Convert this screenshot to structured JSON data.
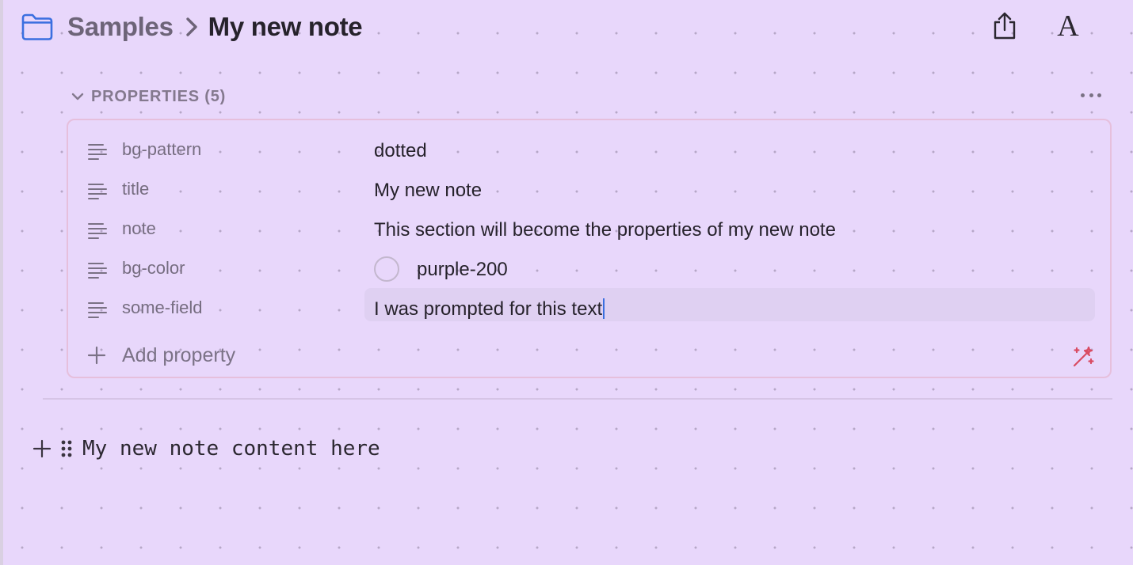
{
  "header": {
    "breadcrumb_parent": "Samples",
    "breadcrumb_current": "My new note",
    "font_button_glyph": "A",
    "icons": [
      "folder-icon",
      "chevron-right-icon",
      "share-icon",
      "font-icon",
      "more-icon"
    ]
  },
  "properties": {
    "title": "PROPERTIES (5)",
    "items": [
      {
        "key": "bg-pattern",
        "value": "dotted"
      },
      {
        "key": "title",
        "value": "My new note"
      },
      {
        "key": "note",
        "value": "This section will become the properties of my new note"
      },
      {
        "key": "bg-color",
        "value": "purple-200"
      },
      {
        "key": "some-field",
        "value": "I was prompted for this text"
      }
    ],
    "add_label": "Add property"
  },
  "content": {
    "text": "My new note content here"
  },
  "colors": {
    "background": "#e8d7fb",
    "folder_icon": "#3b6fe0",
    "panel_border": "#e6bfdc",
    "magic_icon": "#d94b62",
    "caret": "#3b6fe0"
  }
}
